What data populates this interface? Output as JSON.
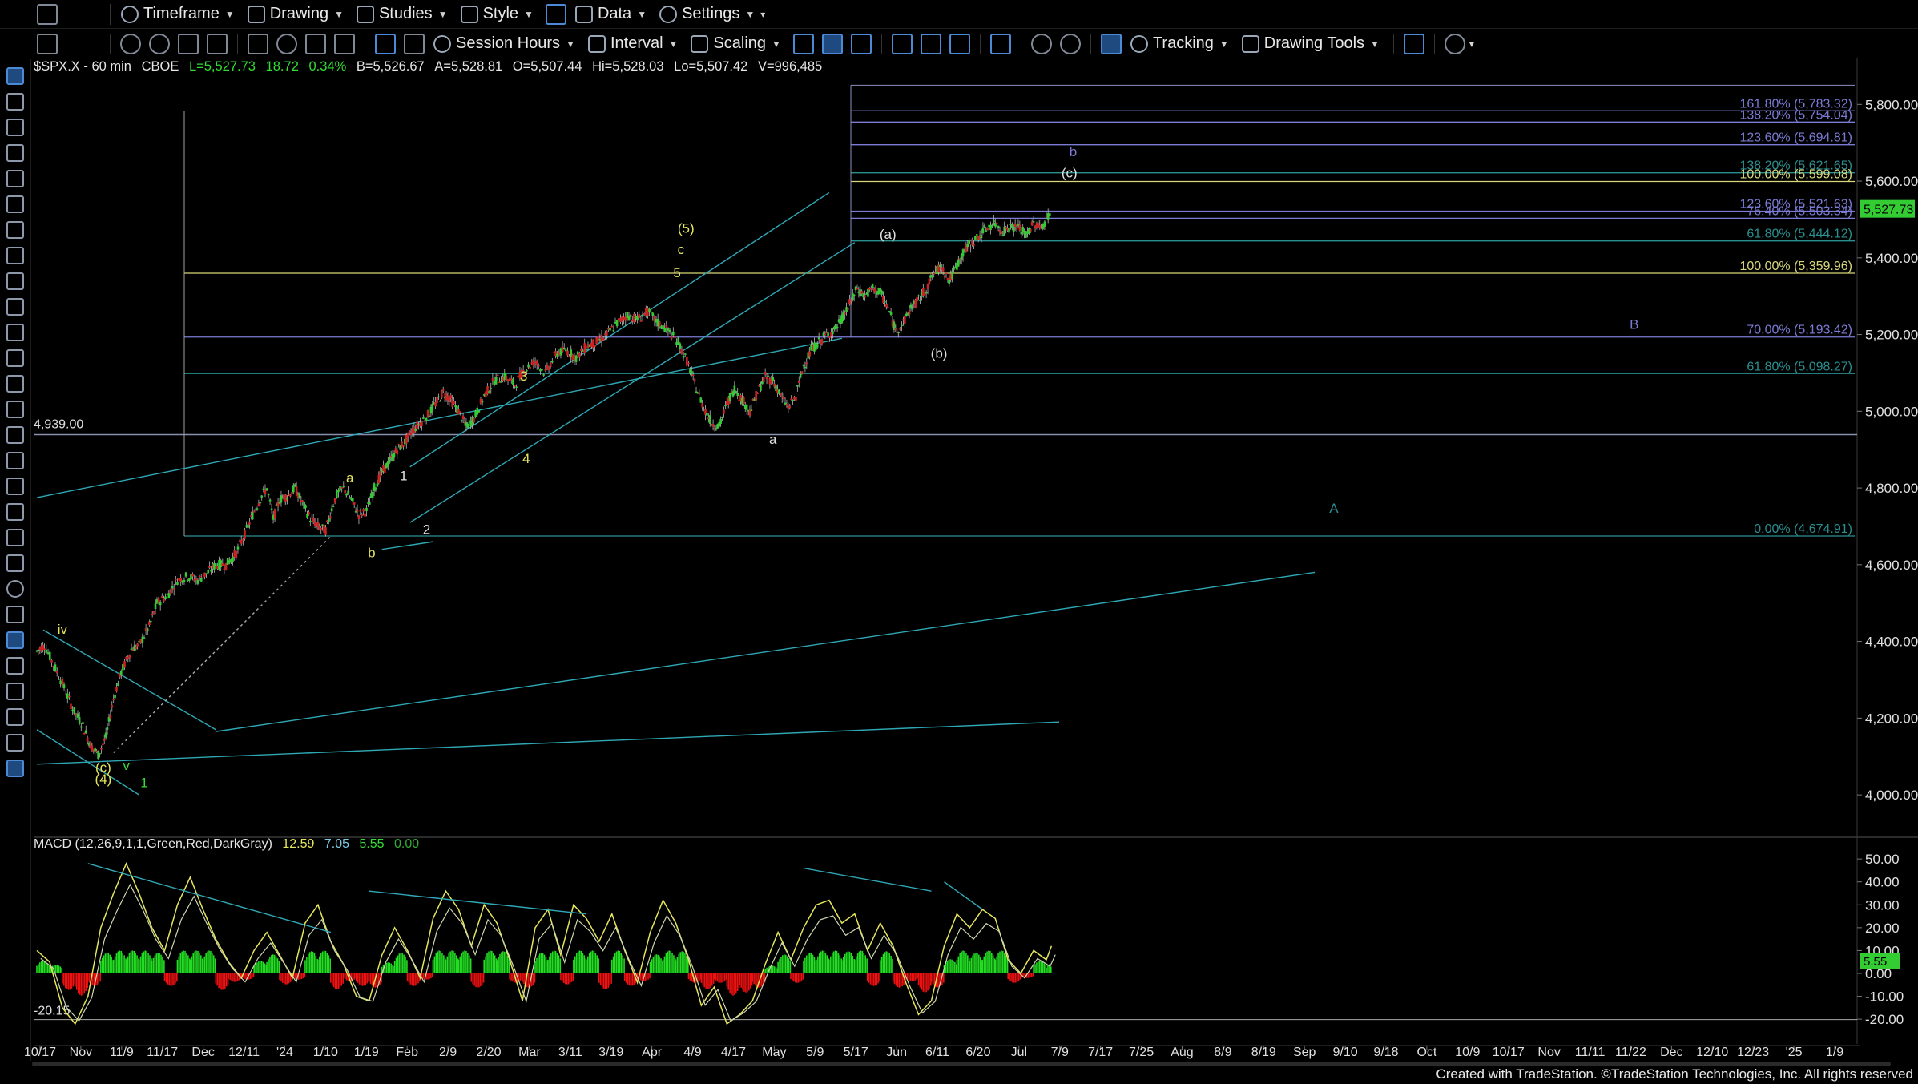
{
  "toolbar1": {
    "timeframe": "Timeframe",
    "drawing": "Drawing",
    "studies": "Studies",
    "style": "Style",
    "data": "Data",
    "settings": "Settings"
  },
  "toolbar2": {
    "session_hours": "Session Hours",
    "interval": "Interval",
    "scaling": "Scaling",
    "tracking": "Tracking",
    "drawing_tools": "Drawing Tools"
  },
  "symbol_bar": {
    "symbol": "$SPX.X - 60 min",
    "exchange": "CBOE",
    "last": "L=5,527.73",
    "change": "18.72",
    "change_pct": "0.34%",
    "bid": "B=5,526.67",
    "ask": "A=5,528.81",
    "open": "O=5,507.44",
    "high": "Hi=5,528.03",
    "low": "Lo=5,507.42",
    "volume": "V=996,485"
  },
  "macd_label": {
    "name": "MACD (12,26,9,1,1,Green,Red,DarkGray)",
    "v1": "12.59",
    "v2": "7.05",
    "v3": "5.55",
    "v4": "0.00"
  },
  "footer": "Created with TradeStation. ©TradeStation Technologies, Inc. All rights reserved",
  "colors": {
    "background": "#000000",
    "up_candle": "#33cc33",
    "down_candle": "#cc2222",
    "fib_purple": "#7b7bd6",
    "fib_teal": "#2a8f8f",
    "fib_yellow": "#d8d87a",
    "channel": "#2fa8b5",
    "label_yellow": "#e6e65c",
    "label_white": "#e0e0e0"
  },
  "chart_data": {
    "type": "candlestick",
    "title": "$SPX.X - 60 min",
    "ylim": [
      3900,
      5880
    ],
    "y_ticks": [
      "5,800.00",
      "5,600.00",
      "5,400.00",
      "5,200.00",
      "5,000.00",
      "4,800.00",
      "4,600.00",
      "4,400.00",
      "4,200.00",
      "4,000.00"
    ],
    "y_tick_values": [
      5800,
      5600,
      5400,
      5200,
      5000,
      4800,
      4600,
      4400,
      4200,
      4000
    ],
    "x_tick_labels": [
      "10/17",
      "Nov",
      "11/9",
      "11/17",
      "Dec",
      "12/11",
      "'24",
      "1/10",
      "1/19",
      "Feb",
      "2/9",
      "2/20",
      "Mar",
      "3/11",
      "3/19",
      "Apr",
      "4/9",
      "4/17",
      "May",
      "5/9",
      "5/17",
      "Jun",
      "6/11",
      "6/20",
      "Jul",
      "7/9",
      "7/17",
      "7/25",
      "Aug",
      "8/9",
      "8/19",
      "Sep",
      "9/10",
      "9/18",
      "Oct",
      "10/9",
      "10/17",
      "Nov",
      "11/11",
      "11/22",
      "Dec",
      "12/10",
      "12/23",
      "'25",
      "1/9"
    ],
    "last_price": "5,527.73",
    "support_line": {
      "label": "4,939.00",
      "value": 4939
    },
    "path_points": [
      [
        0,
        4375
      ],
      [
        6,
        4390
      ],
      [
        13,
        4340
      ],
      [
        20,
        4290
      ],
      [
        28,
        4225
      ],
      [
        36,
        4180
      ],
      [
        42,
        4130
      ],
      [
        48,
        4105
      ],
      [
        54,
        4150
      ],
      [
        60,
        4250
      ],
      [
        66,
        4320
      ],
      [
        74,
        4380
      ],
      [
        80,
        4390
      ],
      [
        88,
        4440
      ],
      [
        94,
        4500
      ],
      [
        102,
        4520
      ],
      [
        110,
        4560
      ],
      [
        118,
        4570
      ],
      [
        126,
        4560
      ],
      [
        134,
        4580
      ],
      [
        140,
        4600
      ],
      [
        148,
        4600
      ],
      [
        156,
        4630
      ],
      [
        164,
        4690
      ],
      [
        170,
        4740
      ],
      [
        176,
        4780
      ],
      [
        180,
        4800
      ],
      [
        185,
        4720
      ],
      [
        190,
        4770
      ],
      [
        196,
        4780
      ],
      [
        202,
        4800
      ],
      [
        208,
        4760
      ],
      [
        214,
        4720
      ],
      [
        220,
        4700
      ],
      [
        226,
        4690
      ],
      [
        232,
        4760
      ],
      [
        236,
        4790
      ],
      [
        240,
        4800
      ],
      [
        246,
        4770
      ],
      [
        252,
        4730
      ],
      [
        258,
        4740
      ],
      [
        264,
        4800
      ],
      [
        270,
        4840
      ],
      [
        276,
        4870
      ],
      [
        282,
        4900
      ],
      [
        288,
        4920
      ],
      [
        294,
        4950
      ],
      [
        300,
        4970
      ],
      [
        306,
        4990
      ],
      [
        312,
        5020
      ],
      [
        318,
        5050
      ],
      [
        324,
        5030
      ],
      [
        330,
        5000
      ],
      [
        336,
        4960
      ],
      [
        342,
        4980
      ],
      [
        350,
        5040
      ],
      [
        358,
        5080
      ],
      [
        366,
        5090
      ],
      [
        374,
        5070
      ],
      [
        382,
        5110
      ],
      [
        390,
        5130
      ],
      [
        398,
        5100
      ],
      [
        406,
        5150
      ],
      [
        414,
        5160
      ],
      [
        422,
        5140
      ],
      [
        430,
        5170
      ],
      [
        438,
        5180
      ],
      [
        446,
        5200
      ],
      [
        454,
        5230
      ],
      [
        462,
        5250
      ],
      [
        470,
        5240
      ],
      [
        478,
        5260
      ],
      [
        486,
        5230
      ],
      [
        494,
        5210
      ],
      [
        502,
        5180
      ],
      [
        510,
        5120
      ],
      [
        516,
        5060
      ],
      [
        522,
        5010
      ],
      [
        528,
        4970
      ],
      [
        534,
        4960
      ],
      [
        540,
        5020
      ],
      [
        546,
        5060
      ],
      [
        552,
        5030
      ],
      [
        558,
        5000
      ],
      [
        564,
        5050
      ],
      [
        570,
        5090
      ],
      [
        576,
        5080
      ],
      [
        582,
        5040
      ],
      [
        588,
        5010
      ],
      [
        594,
        5040
      ],
      [
        600,
        5120
      ],
      [
        606,
        5160
      ],
      [
        612,
        5180
      ],
      [
        618,
        5200
      ],
      [
        624,
        5210
      ],
      [
        630,
        5240
      ],
      [
        636,
        5280
      ],
      [
        642,
        5320
      ],
      [
        648,
        5300
      ],
      [
        654,
        5320
      ],
      [
        660,
        5310
      ],
      [
        666,
        5270
      ],
      [
        672,
        5210
      ],
      [
        678,
        5230
      ],
      [
        684,
        5270
      ],
      [
        690,
        5290
      ],
      [
        696,
        5320
      ],
      [
        702,
        5360
      ],
      [
        708,
        5380
      ],
      [
        714,
        5340
      ],
      [
        720,
        5380
      ],
      [
        726,
        5420
      ],
      [
        732,
        5440
      ],
      [
        738,
        5460
      ],
      [
        744,
        5480
      ],
      [
        750,
        5490
      ],
      [
        756,
        5470
      ],
      [
        762,
        5480
      ],
      [
        768,
        5480
      ],
      [
        774,
        5460
      ],
      [
        780,
        5490
      ],
      [
        786,
        5480
      ],
      [
        790,
        5500
      ],
      [
        794,
        5528
      ]
    ],
    "fib_levels": [
      {
        "label": "161.80% (5,783.32)",
        "value": 5783.32
      },
      {
        "label": "138.20% (5,754.04)",
        "value": 5754.04
      },
      {
        "label": "123.60% (5,694.81)",
        "value": 5694.81
      },
      {
        "label": "138.20% (5,621.65)",
        "value": 5621.65
      },
      {
        "label": "100.00% (5,599.08)",
        "value": 5599.08
      },
      {
        "label": "123.60% (5,521.63)",
        "value": 5521.63
      },
      {
        "label": "76.40% (5,503.34)",
        "value": 5503.34
      },
      {
        "label": "61.80% (5,444.12)",
        "value": 5444.12
      },
      {
        "label": "100.00% (5,359.96)",
        "value": 5359.96
      },
      {
        "label": "70.00% (5,193.42)",
        "value": 5193.42
      },
      {
        "label": "61.80% (5,098.27)",
        "value": 5098.27
      },
      {
        "label": "0.00% (4,674.91)",
        "value": 4674.91
      }
    ],
    "wave_labels": [
      {
        "text": "iv",
        "x": 20,
        "y": 4420,
        "color": "#e6e65c"
      },
      {
        "text": "(c)",
        "x": 52,
        "y": 4060,
        "color": "#e6e65c"
      },
      {
        "text": "(4)",
        "x": 52,
        "y": 4030,
        "color": "#e6e65c"
      },
      {
        "text": "v",
        "x": 70,
        "y": 4065,
        "color": "#33dd33"
      },
      {
        "text": "1",
        "x": 84,
        "y": 4020,
        "color": "#33dd33"
      },
      {
        "text": "a",
        "x": 245,
        "y": 4815,
        "color": "#e6e65c"
      },
      {
        "text": "b",
        "x": 262,
        "y": 4620,
        "color": "#e6e65c"
      },
      {
        "text": "1",
        "x": 287,
        "y": 4820,
        "color": "#e0e0e0"
      },
      {
        "text": "2",
        "x": 305,
        "y": 4680,
        "color": "#e0e0e0"
      },
      {
        "text": "3",
        "x": 381,
        "y": 5080,
        "color": "#e6e65c"
      },
      {
        "text": "4",
        "x": 383,
        "y": 4865,
        "color": "#e6e65c"
      },
      {
        "text": "5",
        "x": 501,
        "y": 5350,
        "color": "#e6e65c"
      },
      {
        "text": "c",
        "x": 504,
        "y": 5410,
        "color": "#e6e65c"
      },
      {
        "text": "(5)",
        "x": 508,
        "y": 5465,
        "color": "#e6e65c"
      },
      {
        "text": "a",
        "x": 576,
        "y": 4915,
        "color": "#e0e0e0"
      },
      {
        "text": "(a)",
        "x": 666,
        "y": 5450,
        "color": "#e0e0e0"
      },
      {
        "text": "(b)",
        "x": 706,
        "y": 5140,
        "color": "#e0e0e0"
      },
      {
        "text": "(c)",
        "x": 808,
        "y": 5610,
        "color": "#e0e0e0"
      },
      {
        "text": "b",
        "x": 811,
        "y": 5665,
        "color": "#7b7bd6"
      },
      {
        "text": "B",
        "x": 1250,
        "y": 5215,
        "color": "#7b7bd6"
      },
      {
        "text": "A",
        "x": 1015,
        "y": 4735,
        "color": "#2a8f8f"
      }
    ],
    "macd": {
      "ylim": [
        -28,
        56
      ],
      "y_ticks": [
        "50.00",
        "40.00",
        "30.00",
        "20.00",
        "10.00",
        "0.00",
        "-10.00",
        "-20.00"
      ],
      "y_tick_values": [
        50,
        40,
        30,
        20,
        10,
        0,
        -10,
        -20
      ],
      "low_marker": "-20.15",
      "current": "5.55",
      "signal_points": [
        [
          0,
          10
        ],
        [
          10,
          5
        ],
        [
          20,
          -15
        ],
        [
          30,
          -22
        ],
        [
          40,
          -10
        ],
        [
          50,
          20
        ],
        [
          60,
          35
        ],
        [
          70,
          48
        ],
        [
          80,
          35
        ],
        [
          90,
          20
        ],
        [
          100,
          10
        ],
        [
          110,
          30
        ],
        [
          120,
          42
        ],
        [
          130,
          28
        ],
        [
          140,
          15
        ],
        [
          150,
          5
        ],
        [
          160,
          -2
        ],
        [
          170,
          10
        ],
        [
          180,
          18
        ],
        [
          190,
          8
        ],
        [
          200,
          -2
        ],
        [
          210,
          22
        ],
        [
          220,
          30
        ],
        [
          230,
          14
        ],
        [
          240,
          4
        ],
        [
          250,
          -10
        ],
        [
          260,
          -12
        ],
        [
          270,
          8
        ],
        [
          280,
          20
        ],
        [
          290,
          10
        ],
        [
          300,
          -2
        ],
        [
          310,
          24
        ],
        [
          320,
          36
        ],
        [
          330,
          28
        ],
        [
          340,
          12
        ],
        [
          350,
          30
        ],
        [
          360,
          22
        ],
        [
          370,
          6
        ],
        [
          380,
          -12
        ],
        [
          390,
          20
        ],
        [
          400,
          28
        ],
        [
          410,
          8
        ],
        [
          420,
          30
        ],
        [
          430,
          24
        ],
        [
          440,
          14
        ],
        [
          450,
          26
        ],
        [
          460,
          10
        ],
        [
          470,
          -4
        ],
        [
          480,
          18
        ],
        [
          490,
          32
        ],
        [
          500,
          22
        ],
        [
          510,
          6
        ],
        [
          520,
          -14
        ],
        [
          530,
          -6
        ],
        [
          540,
          -22
        ],
        [
          550,
          -18
        ],
        [
          560,
          -12
        ],
        [
          570,
          4
        ],
        [
          580,
          18
        ],
        [
          590,
          6
        ],
        [
          600,
          20
        ],
        [
          610,
          30
        ],
        [
          620,
          32
        ],
        [
          630,
          22
        ],
        [
          640,
          26
        ],
        [
          650,
          10
        ],
        [
          660,
          22
        ],
        [
          670,
          12
        ],
        [
          680,
          -4
        ],
        [
          690,
          -18
        ],
        [
          700,
          -12
        ],
        [
          710,
          12
        ],
        [
          720,
          26
        ],
        [
          730,
          20
        ],
        [
          740,
          28
        ],
        [
          750,
          24
        ],
        [
          760,
          6
        ],
        [
          770,
          0
        ],
        [
          780,
          10
        ],
        [
          790,
          6
        ],
        [
          794,
          12
        ]
      ],
      "histogram_sign": [
        1,
        1,
        -1,
        -1,
        -1,
        1,
        1,
        1,
        1,
        1,
        -1,
        1,
        1,
        1,
        -1,
        -1,
        -1,
        1,
        1,
        -1,
        -1,
        1,
        1,
        -1,
        -1,
        -1,
        -1,
        1,
        1,
        -1,
        -1,
        1,
        1,
        1,
        -1,
        1,
        1,
        -1,
        -1,
        1,
        1,
        -1,
        1,
        1,
        -1,
        1,
        -1,
        -1,
        1,
        1,
        1,
        -1,
        -1,
        -1,
        -1,
        -1,
        -1,
        1,
        1,
        -1,
        1,
        1,
        1,
        1,
        1,
        -1,
        1,
        -1,
        -1,
        -1,
        -1,
        1,
        1,
        1,
        1,
        1,
        -1,
        -1,
        1,
        1
      ]
    }
  }
}
